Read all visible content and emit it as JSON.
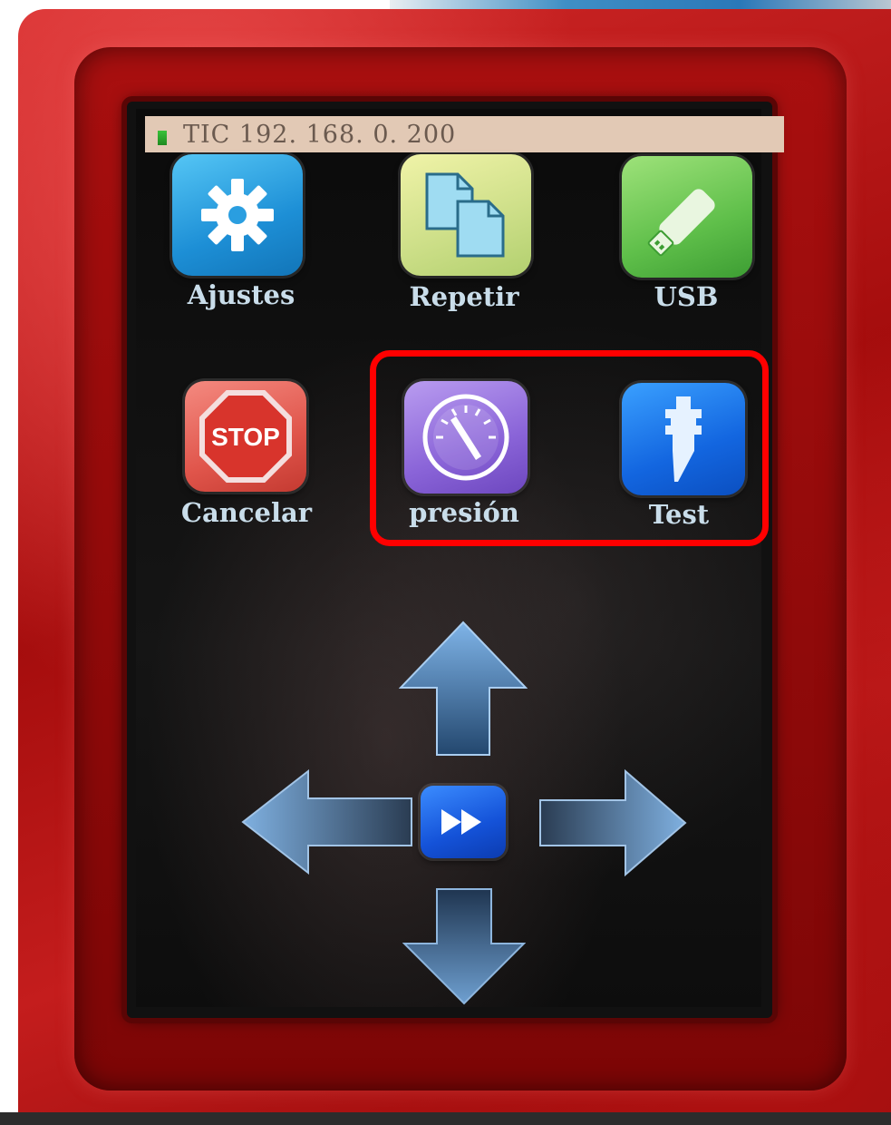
{
  "status_bar": {
    "text": "TIC 192. 168. 0. 200",
    "icon": "signal-icon"
  },
  "menu": {
    "settings": {
      "label": "Ajustes",
      "icon": "gear-icon"
    },
    "repeat": {
      "label": "Repetir",
      "icon": "documents-icon"
    },
    "usb": {
      "label": "USB",
      "icon": "usb-drive-icon"
    },
    "cancel": {
      "label": "Cancelar",
      "icon": "stop-sign-icon",
      "icon_text": "STOP"
    },
    "pressure": {
      "label": "presión",
      "icon": "gauge-icon"
    },
    "test": {
      "label": "Test",
      "icon": "blade-holder-icon"
    }
  },
  "jog_pad": {
    "up": "arrow-up-icon",
    "down": "arrow-down-icon",
    "left": "arrow-left-icon",
    "right": "arrow-right-icon",
    "speed": "fast-forward-icon"
  },
  "colors": {
    "highlight": "#ff0000",
    "bezel": "#c41d1d",
    "status_bar": "#e2c9b5",
    "label": "#c9ddea"
  }
}
